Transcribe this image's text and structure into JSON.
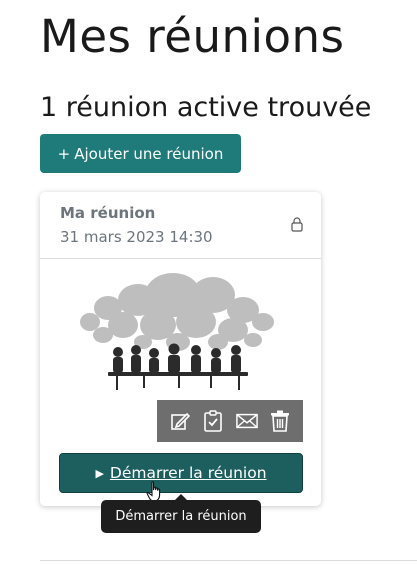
{
  "page": {
    "title": "Mes réunions",
    "count_label": "1 réunion active trouvée"
  },
  "toolbar": {
    "add_icon": "+",
    "add_label": "Ajouter une réunion"
  },
  "meeting_card": {
    "title": "Ma réunion",
    "date": "31 mars 2023 14:30",
    "status_icon": "lock-icon",
    "actions": [
      "edit-icon",
      "clipboard-check-icon",
      "mail-icon",
      "trash-icon"
    ],
    "start_icon": "▶",
    "start_label": "Démarrer la réunion",
    "start_tooltip": "Démarrer la réunion"
  },
  "colors": {
    "primary": "#1f7a7a",
    "start_button": "#1d5f5f",
    "action_bar": "#6e6e6e",
    "tooltip": "#1e1e1e"
  }
}
